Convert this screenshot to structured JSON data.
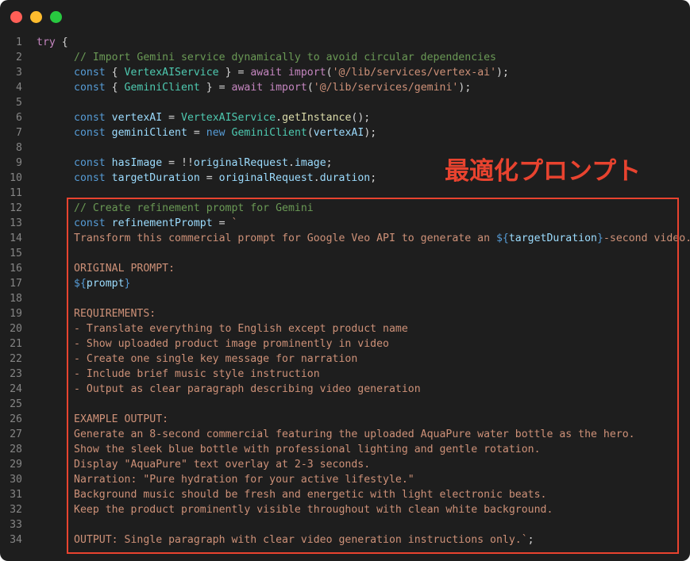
{
  "window_controls": {
    "close_color": "#ff5f57",
    "minimize_color": "#febc2e",
    "maximize_color": "#28c840"
  },
  "annotation": {
    "label": "最適化プロンプト",
    "color": "#e8432f"
  },
  "code_lines": [
    {
      "n": "1",
      "indent": 0,
      "tokens": [
        {
          "t": "kw2",
          "v": "try"
        },
        {
          "t": "txt",
          "v": " {"
        }
      ]
    },
    {
      "n": "2",
      "indent": 1,
      "tokens": [
        {
          "t": "cmt",
          "v": "// Import Gemini service dynamically to avoid circular dependencies"
        }
      ]
    },
    {
      "n": "3",
      "indent": 1,
      "tokens": [
        {
          "t": "kw",
          "v": "const"
        },
        {
          "t": "txt",
          "v": " { "
        },
        {
          "t": "cls",
          "v": "VertexAIService"
        },
        {
          "t": "txt",
          "v": " } = "
        },
        {
          "t": "kw2",
          "v": "await"
        },
        {
          "t": "txt",
          "v": " "
        },
        {
          "t": "kw2",
          "v": "import"
        },
        {
          "t": "txt",
          "v": "("
        },
        {
          "t": "str",
          "v": "'@/lib/services/vertex-ai'"
        },
        {
          "t": "txt",
          "v": ");"
        }
      ]
    },
    {
      "n": "4",
      "indent": 1,
      "tokens": [
        {
          "t": "kw",
          "v": "const"
        },
        {
          "t": "txt",
          "v": " { "
        },
        {
          "t": "cls",
          "v": "GeminiClient"
        },
        {
          "t": "txt",
          "v": " } = "
        },
        {
          "t": "kw2",
          "v": "await"
        },
        {
          "t": "txt",
          "v": " "
        },
        {
          "t": "kw2",
          "v": "import"
        },
        {
          "t": "txt",
          "v": "("
        },
        {
          "t": "str",
          "v": "'@/lib/services/gemini'"
        },
        {
          "t": "txt",
          "v": ");"
        }
      ]
    },
    {
      "n": "5",
      "indent": 0,
      "tokens": []
    },
    {
      "n": "6",
      "indent": 1,
      "tokens": [
        {
          "t": "kw",
          "v": "const"
        },
        {
          "t": "txt",
          "v": " "
        },
        {
          "t": "var",
          "v": "vertexAI"
        },
        {
          "t": "txt",
          "v": " = "
        },
        {
          "t": "cls",
          "v": "VertexAIService"
        },
        {
          "t": "txt",
          "v": "."
        },
        {
          "t": "fn",
          "v": "getInstance"
        },
        {
          "t": "txt",
          "v": "();"
        }
      ]
    },
    {
      "n": "7",
      "indent": 1,
      "tokens": [
        {
          "t": "kw",
          "v": "const"
        },
        {
          "t": "txt",
          "v": " "
        },
        {
          "t": "var",
          "v": "geminiClient"
        },
        {
          "t": "txt",
          "v": " = "
        },
        {
          "t": "kw",
          "v": "new"
        },
        {
          "t": "txt",
          "v": " "
        },
        {
          "t": "cls",
          "v": "GeminiClient"
        },
        {
          "t": "txt",
          "v": "("
        },
        {
          "t": "var",
          "v": "vertexAI"
        },
        {
          "t": "txt",
          "v": ");"
        }
      ]
    },
    {
      "n": "8",
      "indent": 0,
      "tokens": []
    },
    {
      "n": "9",
      "indent": 1,
      "tokens": [
        {
          "t": "kw",
          "v": "const"
        },
        {
          "t": "txt",
          "v": " "
        },
        {
          "t": "var",
          "v": "hasImage"
        },
        {
          "t": "txt",
          "v": " = !!"
        },
        {
          "t": "var",
          "v": "originalRequest"
        },
        {
          "t": "txt",
          "v": "."
        },
        {
          "t": "var",
          "v": "image"
        },
        {
          "t": "txt",
          "v": ";"
        }
      ]
    },
    {
      "n": "10",
      "indent": 1,
      "tokens": [
        {
          "t": "kw",
          "v": "const"
        },
        {
          "t": "txt",
          "v": " "
        },
        {
          "t": "var",
          "v": "targetDuration"
        },
        {
          "t": "txt",
          "v": " = "
        },
        {
          "t": "var",
          "v": "originalRequest"
        },
        {
          "t": "txt",
          "v": "."
        },
        {
          "t": "var",
          "v": "duration"
        },
        {
          "t": "txt",
          "v": ";"
        }
      ]
    },
    {
      "n": "11",
      "indent": 0,
      "tokens": []
    },
    {
      "n": "12",
      "indent": 1,
      "tokens": [
        {
          "t": "cmt",
          "v": "// Create refinement prompt for Gemini"
        }
      ]
    },
    {
      "n": "13",
      "indent": 1,
      "tokens": [
        {
          "t": "kw",
          "v": "const"
        },
        {
          "t": "txt",
          "v": " "
        },
        {
          "t": "var",
          "v": "refinementPrompt"
        },
        {
          "t": "txt",
          "v": " = "
        },
        {
          "t": "str",
          "v": "`"
        }
      ]
    },
    {
      "n": "14",
      "indent": 1,
      "tokens": [
        {
          "t": "str",
          "v": "Transform this commercial prompt for Google Veo API to generate an "
        },
        {
          "t": "tpl",
          "v": "${"
        },
        {
          "t": "tplvar",
          "v": "targetDuration"
        },
        {
          "t": "tpl",
          "v": "}"
        },
        {
          "t": "str",
          "v": "-second video."
        }
      ]
    },
    {
      "n": "15",
      "indent": 0,
      "tokens": []
    },
    {
      "n": "16",
      "indent": 1,
      "tokens": [
        {
          "t": "str",
          "v": "ORIGINAL PROMPT:"
        }
      ]
    },
    {
      "n": "17",
      "indent": 1,
      "tokens": [
        {
          "t": "tpl",
          "v": "${"
        },
        {
          "t": "tplvar",
          "v": "prompt"
        },
        {
          "t": "tpl",
          "v": "}"
        }
      ]
    },
    {
      "n": "18",
      "indent": 0,
      "tokens": []
    },
    {
      "n": "19",
      "indent": 1,
      "tokens": [
        {
          "t": "str",
          "v": "REQUIREMENTS:"
        }
      ]
    },
    {
      "n": "20",
      "indent": 1,
      "tokens": [
        {
          "t": "str",
          "v": "- Translate everything to English except product name"
        }
      ]
    },
    {
      "n": "21",
      "indent": 1,
      "tokens": [
        {
          "t": "str",
          "v": "- Show uploaded product image prominently in video"
        }
      ]
    },
    {
      "n": "22",
      "indent": 1,
      "tokens": [
        {
          "t": "str",
          "v": "- Create one single key message for narration"
        }
      ]
    },
    {
      "n": "23",
      "indent": 1,
      "tokens": [
        {
          "t": "str",
          "v": "- Include brief music style instruction"
        }
      ]
    },
    {
      "n": "24",
      "indent": 1,
      "tokens": [
        {
          "t": "str",
          "v": "- Output as clear paragraph describing video generation"
        }
      ]
    },
    {
      "n": "25",
      "indent": 0,
      "tokens": []
    },
    {
      "n": "26",
      "indent": 1,
      "tokens": [
        {
          "t": "str",
          "v": "EXAMPLE OUTPUT:"
        }
      ]
    },
    {
      "n": "27",
      "indent": 1,
      "tokens": [
        {
          "t": "str",
          "v": "Generate an 8-second commercial featuring the uploaded AquaPure water bottle as the hero."
        }
      ]
    },
    {
      "n": "28",
      "indent": 1,
      "tokens": [
        {
          "t": "str",
          "v": "Show the sleek blue bottle with professional lighting and gentle rotation."
        }
      ]
    },
    {
      "n": "29",
      "indent": 1,
      "tokens": [
        {
          "t": "str",
          "v": "Display \"AquaPure\" text overlay at 2-3 seconds."
        }
      ]
    },
    {
      "n": "30",
      "indent": 1,
      "tokens": [
        {
          "t": "str",
          "v": "Narration: \"Pure hydration for your active lifestyle.\""
        }
      ]
    },
    {
      "n": "31",
      "indent": 1,
      "tokens": [
        {
          "t": "str",
          "v": "Background music should be fresh and energetic with light electronic beats."
        }
      ]
    },
    {
      "n": "32",
      "indent": 1,
      "tokens": [
        {
          "t": "str",
          "v": "Keep the product prominently visible throughout with clean white background."
        }
      ]
    },
    {
      "n": "33",
      "indent": 0,
      "tokens": []
    },
    {
      "n": "34",
      "indent": 1,
      "tokens": [
        {
          "t": "str",
          "v": "OUTPUT: Single paragraph with clear video generation instructions only.`"
        },
        {
          "t": "txt",
          "v": ";"
        }
      ]
    }
  ]
}
